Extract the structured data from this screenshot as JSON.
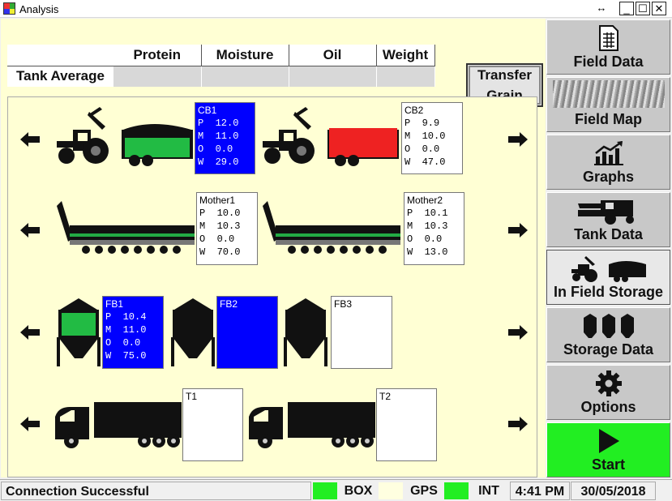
{
  "window": {
    "title": "Analysis",
    "controls": [
      "↔",
      "_",
      "☐",
      "✕"
    ]
  },
  "tank_average": {
    "row_label": "Tank Average",
    "columns": [
      "Protein",
      "Moisture",
      "Oil",
      "Weight"
    ],
    "values": [
      "",
      "",
      "",
      ""
    ]
  },
  "transfer_button": {
    "line1": "Transfer",
    "line2": "Grain"
  },
  "containers": {
    "cb1": {
      "name": "CB1",
      "p": "P  12.0",
      "m": "M  11.0",
      "o": "O  0.0",
      "w": "W  29.0",
      "fill_color": "#22bb44"
    },
    "cb2": {
      "name": "CB2",
      "p": "P  9.9",
      "m": "M  10.0",
      "o": "O  0.0",
      "w": "W  47.0",
      "fill_color": "#ee2222"
    },
    "mother1": {
      "name": "Mother1",
      "p": "P  10.0",
      "m": "M  10.3",
      "o": "O  0.0",
      "w": "W  70.0"
    },
    "mother2": {
      "name": "Mother2",
      "p": "P  10.1",
      "m": "M  10.3",
      "o": "O  0.0",
      "w": "W  13.0"
    },
    "fb1": {
      "name": "FB1",
      "p": "P  10.4",
      "m": "M  11.0",
      "o": "O  0.0",
      "w": "W  75.0",
      "fill_color": "#22bb44"
    },
    "fb2": {
      "name": "FB2"
    },
    "fb3": {
      "name": "FB3"
    },
    "t1": {
      "name": "T1"
    },
    "t2": {
      "name": "T2"
    }
  },
  "sidebar": {
    "items": [
      {
        "label": "Field Data",
        "icon": "spreadsheet-icon"
      },
      {
        "label": "Field Map",
        "icon": "map-icon"
      },
      {
        "label": "Graphs",
        "icon": "chart-icon"
      },
      {
        "label": "Tank Data",
        "icon": "harvester-icon"
      },
      {
        "label": "In Field Storage",
        "icon": "chaser-bin-icon"
      },
      {
        "label": "Storage Data",
        "icon": "silo-icon"
      },
      {
        "label": "Options",
        "icon": "gear-icon"
      },
      {
        "label": "Start",
        "icon": "play-icon"
      }
    ]
  },
  "status": {
    "message": "Connection Successful",
    "box": "BOX",
    "gps": "GPS",
    "int": "INT",
    "time": "4:41 PM",
    "date": "30/05/2018",
    "colors": {
      "box": "#22ee22",
      "gps": "#ffffe0",
      "int": "#22ee22"
    }
  }
}
